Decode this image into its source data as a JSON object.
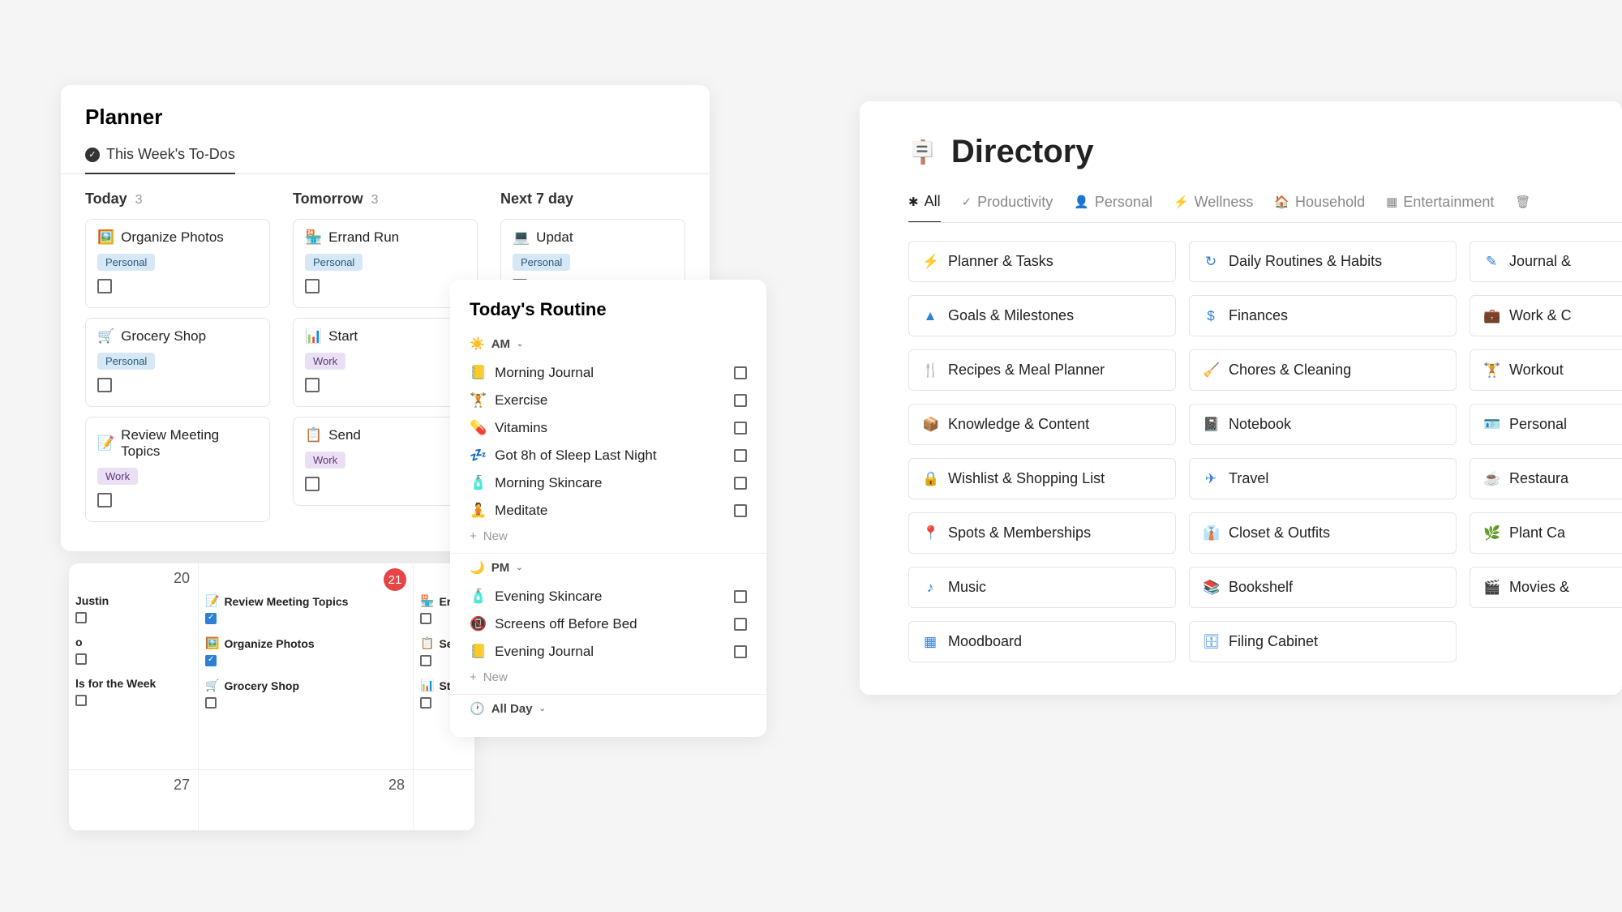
{
  "planner": {
    "title": "Planner",
    "tab": "This Week's To-Dos",
    "columns": [
      {
        "name": "Today",
        "count": "3",
        "tasks": [
          {
            "emoji": "🖼️",
            "title": "Organize Photos",
            "tag": "Personal",
            "tagClass": "personal"
          },
          {
            "emoji": "🛒",
            "title": "Grocery Shop",
            "tag": "Personal",
            "tagClass": "personal"
          },
          {
            "emoji": "📝",
            "title": "Review Meeting Topics",
            "tag": "Work",
            "tagClass": "work"
          }
        ]
      },
      {
        "name": "Tomorrow",
        "count": "3",
        "tasks": [
          {
            "emoji": "🏪",
            "title": "Errand Run",
            "tag": "Personal",
            "tagClass": "personal"
          },
          {
            "emoji": "📊",
            "title": "Start",
            "tag": "Work",
            "tagClass": "work"
          },
          {
            "emoji": "📋",
            "title": "Send",
            "tag": "Work",
            "tagClass": "work"
          }
        ]
      },
      {
        "name": "Next 7 day",
        "count": "",
        "tasks": [
          {
            "emoji": "💻",
            "title": "Updat",
            "tag": "Personal",
            "tagClass": "personal"
          }
        ]
      }
    ]
  },
  "routine": {
    "title": "Today's Routine",
    "am_label": "AM",
    "pm_label": "PM",
    "allday_label": "All Day",
    "new_label": "New",
    "am": [
      {
        "emoji": "📒",
        "label": "Morning Journal"
      },
      {
        "emoji": "🏋️",
        "label": "Exercise"
      },
      {
        "emoji": "💊",
        "label": "Vitamins"
      },
      {
        "emoji": "💤",
        "label": "Got 8h of Sleep Last Night"
      },
      {
        "emoji": "🧴",
        "label": "Morning Skincare"
      },
      {
        "emoji": "🧘",
        "label": "Meditate"
      }
    ],
    "pm": [
      {
        "emoji": "🧴",
        "label": "Evening Skincare"
      },
      {
        "emoji": "📵",
        "label": "Screens off Before Bed"
      },
      {
        "emoji": "📒",
        "label": "Evening Journal"
      }
    ]
  },
  "calendar": {
    "cells": [
      {
        "date": "20",
        "events": [
          {
            "label": "Justin",
            "checked": false,
            "emoji": ""
          },
          {
            "label": "o",
            "checked": false,
            "emoji": ""
          },
          {
            "label": "ls for the Week",
            "checked": false,
            "emoji": ""
          }
        ]
      },
      {
        "date": "21",
        "badge": true,
        "events": [
          {
            "label": "Review Meeting Topics",
            "checked": true,
            "emoji": "📝"
          },
          {
            "label": "Organize Photos",
            "checked": true,
            "emoji": "🖼️"
          },
          {
            "label": "Grocery Shop",
            "checked": false,
            "emoji": "🛒"
          }
        ]
      },
      {
        "date": "",
        "events": [
          {
            "label": "Erra",
            "checked": false,
            "emoji": "🏪"
          },
          {
            "label": "Ser",
            "checked": false,
            "emoji": "📋"
          },
          {
            "label": "Sta",
            "checked": false,
            "emoji": "📊"
          }
        ]
      },
      {
        "date": "27",
        "events": []
      },
      {
        "date": "28",
        "events": []
      },
      {
        "date": "",
        "events": []
      }
    ]
  },
  "directory": {
    "title": "Directory",
    "tabs": [
      {
        "icon": "✱",
        "label": "All",
        "active": true
      },
      {
        "icon": "✓",
        "label": "Productivity"
      },
      {
        "icon": "👤",
        "label": "Personal"
      },
      {
        "icon": "⚡",
        "label": "Wellness"
      },
      {
        "icon": "🏠",
        "label": "Household"
      },
      {
        "icon": "▦",
        "label": "Entertainment"
      },
      {
        "icon": "🗑",
        "label": ""
      }
    ],
    "items": [
      {
        "icon": "⚡",
        "label": "Planner & Tasks"
      },
      {
        "icon": "↻",
        "label": "Daily Routines & Habits"
      },
      {
        "icon": "✎",
        "label": "Journal &"
      },
      {
        "icon": "▲",
        "label": "Goals & Milestones"
      },
      {
        "icon": "$",
        "label": "Finances"
      },
      {
        "icon": "💼",
        "label": "Work & C"
      },
      {
        "icon": "🍴",
        "label": "Recipes & Meal Planner"
      },
      {
        "icon": "🧹",
        "label": "Chores & Cleaning"
      },
      {
        "icon": "🏋",
        "label": "Workout"
      },
      {
        "icon": "📦",
        "label": "Knowledge & Content"
      },
      {
        "icon": "📓",
        "label": "Notebook"
      },
      {
        "icon": "🪪",
        "label": "Personal"
      },
      {
        "icon": "🔒",
        "label": "Wishlist & Shopping List"
      },
      {
        "icon": "✈",
        "label": "Travel"
      },
      {
        "icon": "☕",
        "label": "Restaura"
      },
      {
        "icon": "📍",
        "label": "Spots & Memberships"
      },
      {
        "icon": "👔",
        "label": "Closet & Outfits"
      },
      {
        "icon": "🌿",
        "label": "Plant Ca"
      },
      {
        "icon": "♪",
        "label": "Music"
      },
      {
        "icon": "📚",
        "label": "Bookshelf"
      },
      {
        "icon": "🎬",
        "label": "Movies &"
      },
      {
        "icon": "▦",
        "label": "Moodboard"
      },
      {
        "icon": "🗄",
        "label": "Filing Cabinet"
      }
    ]
  }
}
